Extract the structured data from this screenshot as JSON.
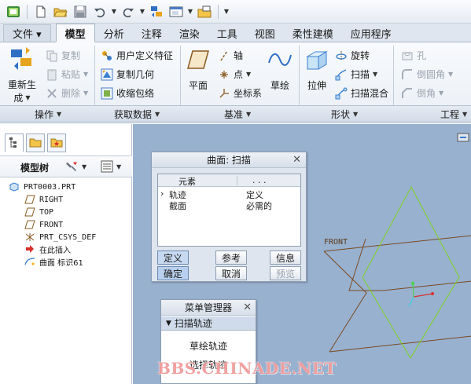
{
  "quick_access": {
    "icons": [
      "app-icon",
      "new-icon",
      "open-icon",
      "save-icon",
      "undo-icon",
      "redo-icon",
      "regenerate-icon",
      "windows-icon",
      "close-window-icon",
      "customize-icon"
    ]
  },
  "tabs": [
    {
      "label": "文件 ▾",
      "active": false
    },
    {
      "label": "模型",
      "active": true
    },
    {
      "label": "分析",
      "active": false
    },
    {
      "label": "注释",
      "active": false
    },
    {
      "label": "渲染",
      "active": false
    },
    {
      "label": "工具",
      "active": false
    },
    {
      "label": "视图",
      "active": false
    },
    {
      "label": "柔性建模",
      "active": false
    },
    {
      "label": "应用程序",
      "active": false
    }
  ],
  "ribbon": {
    "operations": {
      "regenerate_line1": "重新生",
      "regenerate_line2": "成",
      "copy": "复制",
      "paste": "粘贴",
      "delete": "删除",
      "group_label": "操作"
    },
    "get_data": {
      "udf": "用户定义特征",
      "copy_geometry": "复制几何",
      "shrinkwrap": "收缩包络",
      "group_label": "获取数据"
    },
    "datum": {
      "plane": "平面",
      "axis": "轴",
      "point": "点",
      "csys": "坐标系",
      "sketch": "草绘",
      "group_label": "基准"
    },
    "shapes": {
      "extrude": "拉伸",
      "revolve": "旋转",
      "sweep": "扫描",
      "swept_blend": "扫描混合",
      "group_label": "形状"
    },
    "engineering": {
      "hole": "孔",
      "round": "倒圆角",
      "chamfer": "倒角",
      "group_label": "工程"
    }
  },
  "model_tree": {
    "title": "模型树",
    "items": [
      {
        "label": "PRT0003.PRT",
        "icon": "part-icon"
      },
      {
        "label": "RIGHT",
        "icon": "datum-plane-icon"
      },
      {
        "label": "TOP",
        "icon": "datum-plane-icon"
      },
      {
        "label": "FRONT",
        "icon": "datum-plane-icon"
      },
      {
        "label": "PRT_CSYS_DEF",
        "icon": "csys-icon"
      },
      {
        "label": "在此插入",
        "icon": "insert-here-icon"
      },
      {
        "label": "曲面 标识61",
        "icon": "surface-icon"
      }
    ]
  },
  "sweep_dialog": {
    "title": "曲面: 扫描",
    "col_element": "元素",
    "col_info": ". . .",
    "rows": [
      {
        "element": "轨迹",
        "info": "定义",
        "current": true
      },
      {
        "element": "截面",
        "info": "必需的",
        "current": false
      }
    ],
    "buttons": {
      "define": "定义",
      "reference": "参考",
      "info": "信息",
      "ok": "确定",
      "cancel": "取消",
      "preview": "预览"
    }
  },
  "menu_manager": {
    "title": "菜单管理器",
    "submenu": "扫描轨迹",
    "items": [
      "草绘轨迹",
      "选择轨迹"
    ]
  },
  "viewport": {
    "plane_label": "FRONT",
    "colors": {
      "background": "#98b1cf",
      "plane_brown": "#7a4a22",
      "plane_green": "#7ed321"
    }
  },
  "watermark": "BBS.CHINADE.NET"
}
